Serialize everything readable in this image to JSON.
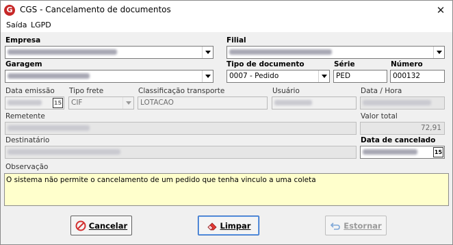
{
  "window": {
    "title": "CGS - Cancelamento de documentos",
    "close_glyph": "✕"
  },
  "menu": [
    "Saída",
    "LGPD"
  ],
  "form": {
    "empresa_label": "Empresa",
    "filial_label": "Filial",
    "garagem_label": "Garagem",
    "tipo_documento_label": "Tipo de documento",
    "tipo_documento_value": "0007 - Pedido",
    "serie_label": "Série",
    "serie_value": "PED",
    "numero_label": "Número",
    "numero_value": "000132",
    "data_emissao_label": "Data emissão",
    "tipo_frete_label": "Tipo frete",
    "tipo_frete_value": "CIF",
    "classificacao_label": "Classificação transporte",
    "classificacao_value": "LOTACAO",
    "usuario_label": "Usuário",
    "data_hora_label": "Data / Hora",
    "remetente_label": "Remetente",
    "valor_total_label": "Valor total",
    "valor_total_value": "72,91",
    "destinatario_label": "Destinatário",
    "data_cancelado_label": "Data de cancelado",
    "observacao_label": "Observação",
    "observacao_value": "O sistema não permite o cancelamento de um pedido que tenha vinculo a uma coleta",
    "calendar_glyph": "15"
  },
  "buttons": {
    "cancelar": {
      "label": "Cancelar",
      "icon": "no-entry-icon",
      "color": "#d32f2f"
    },
    "limpar": {
      "label": "Limpar",
      "icon": "eraser-icon",
      "color": "#e53935"
    },
    "estornar": {
      "label": "Estornar",
      "icon": "undo-arrow-icon",
      "color": "#7fa8d8"
    }
  },
  "colors": {
    "observation_bg": "#ffffcc",
    "brand": "#c62828",
    "focus_border": "#1f5fbf"
  }
}
